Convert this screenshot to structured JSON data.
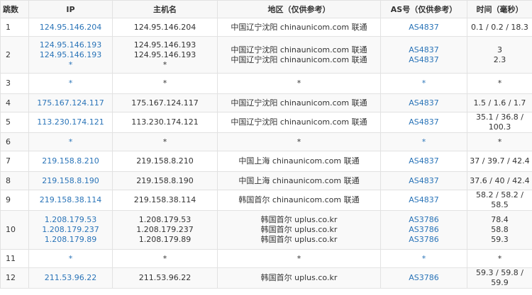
{
  "columns": [
    "跳数",
    "IP",
    "主机名",
    "地区（仅供参考）",
    "AS号（仅供参考）",
    "时间（毫秒）"
  ],
  "rows": [
    {
      "hop": "1",
      "ips": [
        "124.95.146.204"
      ],
      "hosts": [
        "124.95.146.204"
      ],
      "areas": [
        "中国辽宁沈阳 chinaunicom.com 联通"
      ],
      "as": [
        "AS4837"
      ],
      "times": [
        "0.1 / 0.2 / 18.3"
      ]
    },
    {
      "hop": "2",
      "ips": [
        "124.95.146.193",
        "124.95.146.193",
        "*"
      ],
      "hosts": [
        "124.95.146.193",
        "124.95.146.193",
        "*"
      ],
      "areas": [
        "中国辽宁沈阳 chinaunicom.com 联通",
        "中国辽宁沈阳 chinaunicom.com 联通"
      ],
      "as": [
        "AS4837",
        "AS4837"
      ],
      "times": [
        "3",
        "2.3"
      ]
    },
    {
      "hop": "3",
      "ips": [
        "*"
      ],
      "hosts": [
        "*"
      ],
      "areas": [
        "*"
      ],
      "as": [
        "*"
      ],
      "times": [
        "*"
      ]
    },
    {
      "hop": "4",
      "ips": [
        "175.167.124.117"
      ],
      "hosts": [
        "175.167.124.117"
      ],
      "areas": [
        "中国辽宁沈阳 chinaunicom.com 联通"
      ],
      "as": [
        "AS4837"
      ],
      "times": [
        "1.5 / 1.6 / 1.7"
      ]
    },
    {
      "hop": "5",
      "ips": [
        "113.230.174.121"
      ],
      "hosts": [
        "113.230.174.121"
      ],
      "areas": [
        "中国辽宁沈阳 chinaunicom.com 联通"
      ],
      "as": [
        "AS4837"
      ],
      "times": [
        "35.1 / 36.8 / 100.3"
      ]
    },
    {
      "hop": "6",
      "ips": [
        "*"
      ],
      "hosts": [
        "*"
      ],
      "areas": [
        "*"
      ],
      "as": [
        "*"
      ],
      "times": [
        "*"
      ]
    },
    {
      "hop": "7",
      "ips": [
        "219.158.8.210"
      ],
      "hosts": [
        "219.158.8.210"
      ],
      "areas": [
        "中国上海 chinaunicom.com 联通"
      ],
      "as": [
        "AS4837"
      ],
      "times": [
        "37 / 39.7 / 42.4"
      ]
    },
    {
      "hop": "8",
      "ips": [
        "219.158.8.190"
      ],
      "hosts": [
        "219.158.8.190"
      ],
      "areas": [
        "中国上海 chinaunicom.com 联通"
      ],
      "as": [
        "AS4837"
      ],
      "times": [
        "37.6 / 40 / 42.4"
      ]
    },
    {
      "hop": "9",
      "ips": [
        "219.158.38.114"
      ],
      "hosts": [
        "219.158.38.114"
      ],
      "areas": [
        "韩国首尔 chinaunicom.com 联通"
      ],
      "as": [
        "AS4837"
      ],
      "times": [
        "58.2 / 58.2 / 58.5"
      ]
    },
    {
      "hop": "10",
      "ips": [
        "1.208.179.53",
        "1.208.179.237",
        "1.208.179.89"
      ],
      "hosts": [
        "1.208.179.53",
        "1.208.179.237",
        "1.208.179.89"
      ],
      "areas": [
        "韩国首尔 uplus.co.kr",
        "韩国首尔 uplus.co.kr",
        "韩国首尔 uplus.co.kr"
      ],
      "as": [
        "AS3786",
        "AS3786",
        "AS3786"
      ],
      "times": [
        "78.4",
        "58.8",
        "59.3"
      ]
    },
    {
      "hop": "11",
      "ips": [
        "*"
      ],
      "hosts": [
        "*"
      ],
      "areas": [
        "*"
      ],
      "as": [
        "*"
      ],
      "times": [
        "*"
      ]
    },
    {
      "hop": "12",
      "ips": [
        "211.53.96.22"
      ],
      "hosts": [
        "211.53.96.22"
      ],
      "areas": [
        "韩国首尔 uplus.co.kr"
      ],
      "as": [
        "AS3786"
      ],
      "times": [
        "59.3 / 59.8 / 59.9"
      ]
    }
  ]
}
